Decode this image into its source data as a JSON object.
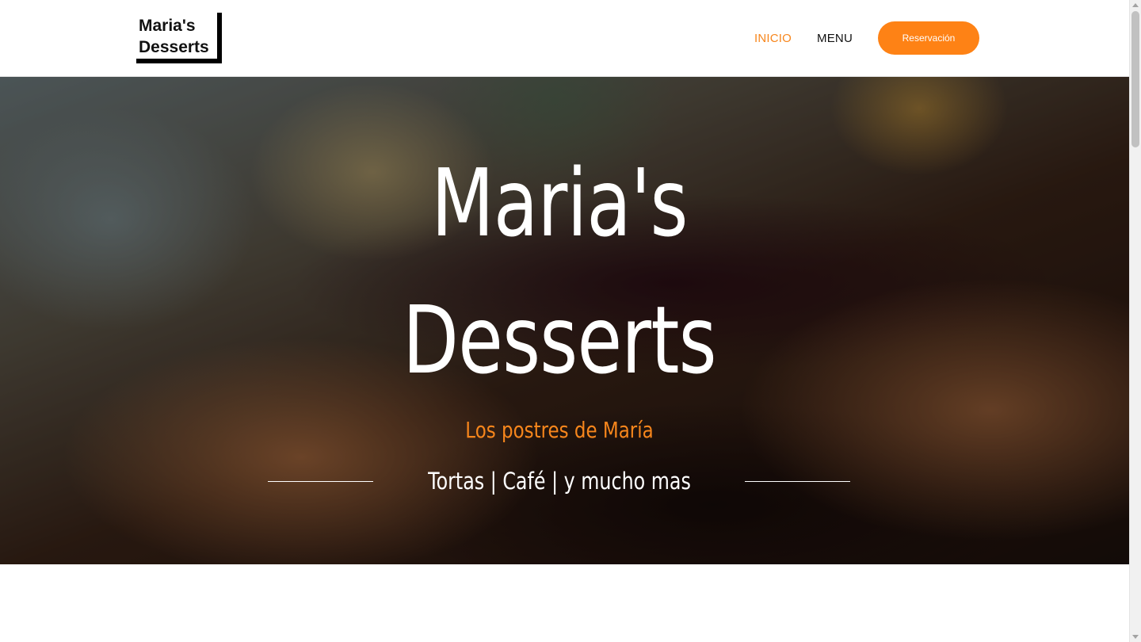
{
  "header": {
    "logo_line1": "Maria's",
    "logo_line2": "Desserts",
    "nav": {
      "inicio": "INICIO",
      "menu": "MENU"
    },
    "reserve_label": "Reservación"
  },
  "hero": {
    "title_line1": "Maria's",
    "title_line2": "Desserts",
    "subtitle": "Los postres de María",
    "tagline": "Tortas | Café | y mucho mas"
  },
  "colors": {
    "accent": "#fe8215",
    "text_dark": "#111111",
    "text_light": "#ffffff"
  },
  "icons": {
    "scroll_up": "chevron-up-icon",
    "scroll_down": "chevron-down-icon"
  }
}
